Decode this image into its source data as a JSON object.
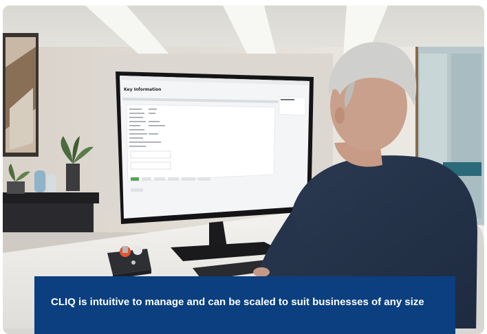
{
  "photo": {
    "subject": "office-worker-at-monitor",
    "screen_title": "Key Information",
    "device": "key-cabinet-icon"
  },
  "caption": {
    "text": "CLIQ is intuitive to manage and can be scaled to suit businesses of any size"
  },
  "colors": {
    "caption_bg": "#0b3f7f",
    "caption_fg": "#ffffff"
  }
}
